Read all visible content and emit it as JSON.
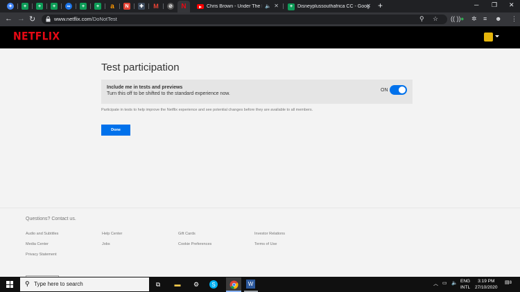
{
  "browser": {
    "tabs": [
      {
        "title": "Chris Brown - Under The Influ",
        "favicon": "youtube-icon",
        "audio": true
      },
      {
        "title": "Disneyplussouthafrica CC - Goog",
        "favicon": "sheets-icon"
      }
    ],
    "url_host": "www.netflix.com",
    "url_path": "/DoNotTest",
    "colors": {
      "tab_strip": "#202124",
      "toolbar": "#35363a"
    }
  },
  "netflix": {
    "logo": "NETFLIX",
    "brand_color": "#e50914",
    "accent_color": "#0071eb"
  },
  "page": {
    "title": "Test participation",
    "setting_label": "Include me in tests and previews",
    "setting_desc": "Turn this off to be shifted to the standard experience now.",
    "toggle_state": "ON",
    "info": "Participate in tests to help improve the Netflix experience and see potential changes before they are available to all members.",
    "done_label": "Done"
  },
  "footer": {
    "contact": "Questions? Contact us.",
    "links": [
      "Audio and Subtitles",
      "Help Center",
      "Gift Cards",
      "Investor Relations",
      "Media Center",
      "Jobs",
      "Cookie Preferences",
      "Terms of Use",
      "Privacy Statement"
    ]
  },
  "taskbar": {
    "search_placeholder": "Type here to search",
    "lang_1": "ENG",
    "lang_2": "INTL",
    "time": "3:19 PM",
    "date": "27/10/2020",
    "notification_count": "8"
  }
}
